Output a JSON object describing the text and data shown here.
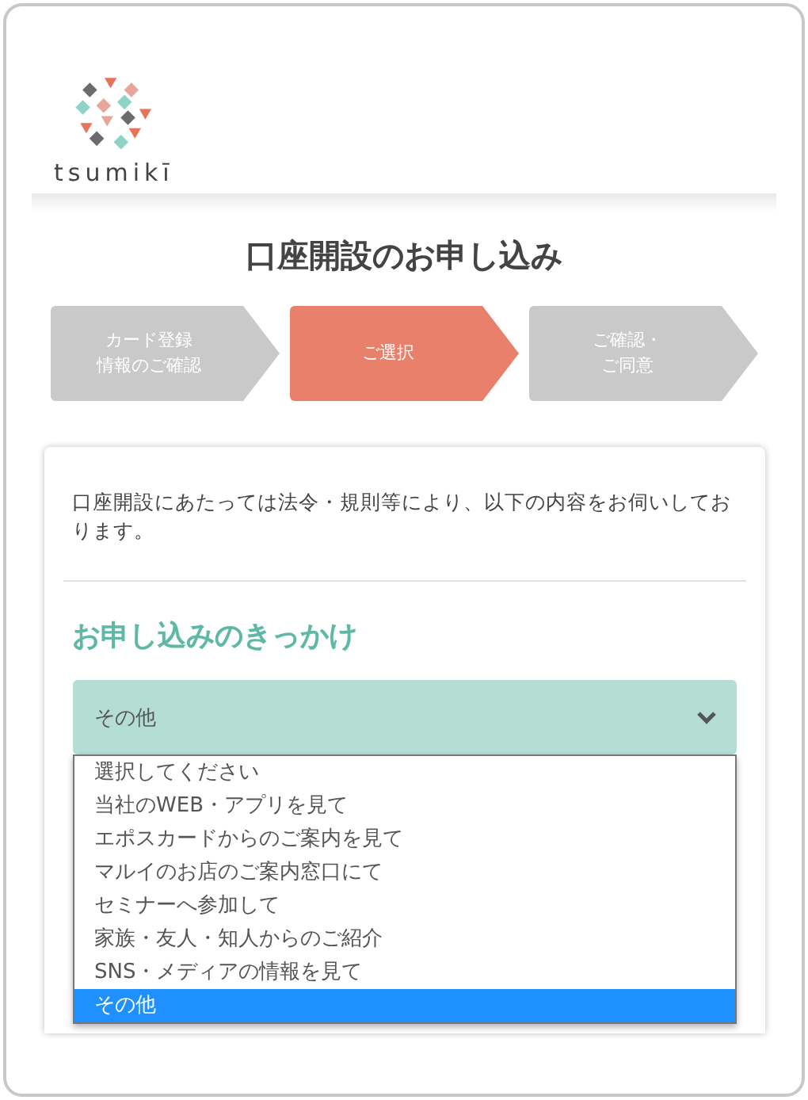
{
  "logo": {
    "text": "tsumikī"
  },
  "title": "口座開設のお申し込み",
  "steps": [
    {
      "lines": [
        "カード登録",
        "情報のご確認"
      ],
      "selected": false
    },
    {
      "lines": [
        "ご選択"
      ],
      "selected": true
    },
    {
      "lines": [
        "ご確認・",
        "ご同意"
      ],
      "selected": false
    }
  ],
  "card": {
    "intro": "口座開設にあたっては法令・規則等により、以下の内容をお伺いしております。",
    "heading": "お申し込みのきっかけ",
    "select": {
      "value": "その他",
      "expanded": true,
      "options": [
        {
          "label": "選択してください",
          "selected": false
        },
        {
          "label": "当社のWEB・アプリを見て",
          "selected": false
        },
        {
          "label": "エポスカードからのご案内を見て",
          "selected": false
        },
        {
          "label": "マルイのお店のご案内窓口にて",
          "selected": false
        },
        {
          "label": "セミナーへ参加して",
          "selected": false
        },
        {
          "label": "家族・友人・知人からのご紹介",
          "selected": false
        },
        {
          "label": "SNS・メディアの情報を見て",
          "selected": false
        },
        {
          "label": "その他",
          "selected": true
        }
      ]
    }
  }
}
